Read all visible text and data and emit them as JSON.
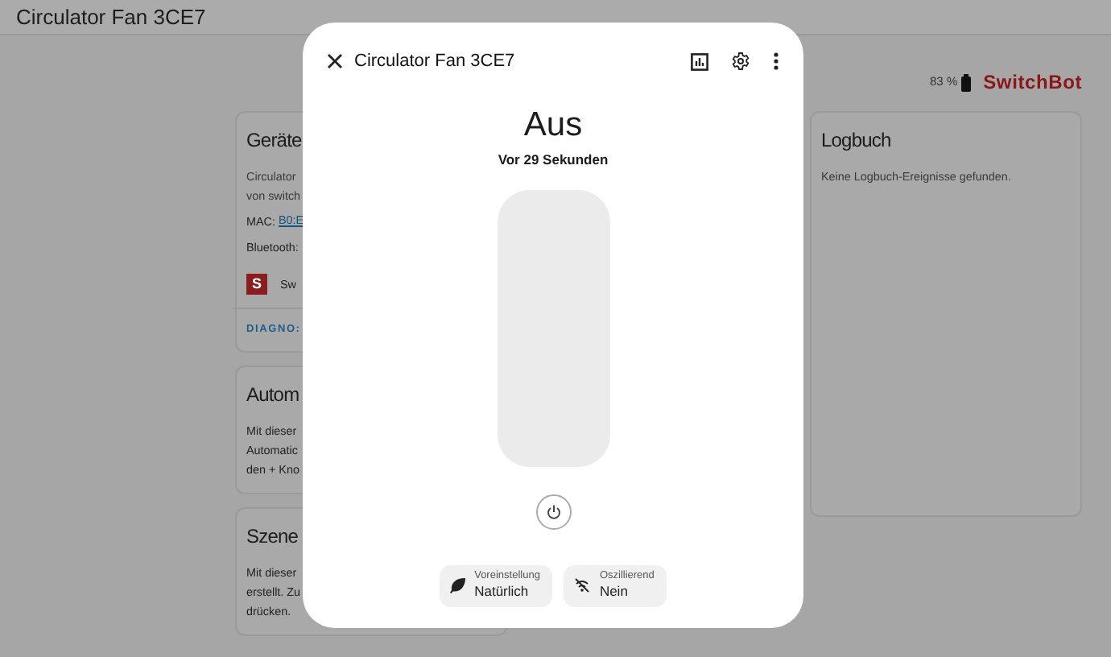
{
  "app_bar": {
    "title": "Circulator Fan 3CE7"
  },
  "header": {
    "battery": "83 %",
    "brand": "SwitchBot"
  },
  "device_card": {
    "title": "Geräte",
    "description": [
      "Circulator",
      "von switch"
    ],
    "mac_label": "MAC:",
    "mac_value": "B0:E",
    "bluetooth_label": "Bluetooth:",
    "integration_logo": "S",
    "integration": "Sw",
    "action": "DIAGNO:"
  },
  "info_cards": [
    {
      "title": "Autom",
      "lines": [
        "Mit dieser",
        "Automatic",
        "den + Kno"
      ]
    },
    {
      "title": "Szene",
      "lines": [
        "Mit dieser",
        "erstellt. Zu",
        "drücken."
      ]
    }
  ],
  "logbook": {
    "title": "Logbuch",
    "empty_text": "Keine Logbuch-Ereignisse gefunden."
  },
  "dialog": {
    "title": "Circulator Fan 3CE7",
    "state": "Aus",
    "last_changed": "Vor 29 Sekunden",
    "speed": {
      "level": 0
    },
    "power": {
      "on": false
    },
    "features": [
      {
        "kind": "preset",
        "label": "Voreinstellung",
        "value": "Natürlich"
      },
      {
        "kind": "oscillate",
        "label": "Oszillierend",
        "value": "Nein"
      }
    ]
  }
}
